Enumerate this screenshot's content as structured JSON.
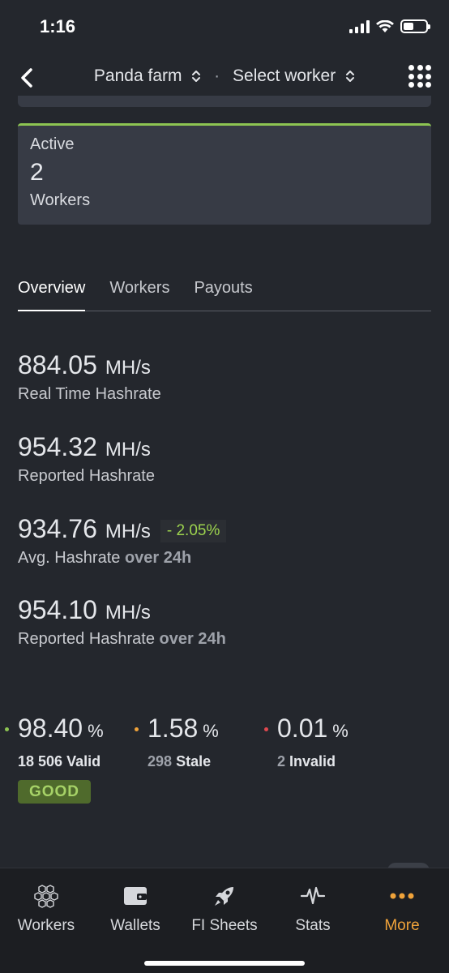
{
  "status_bar": {
    "time": "1:16"
  },
  "nav": {
    "farm": "Panda farm",
    "separator": "·",
    "worker": "Select worker"
  },
  "active_card": {
    "label": "Active",
    "value": "2",
    "sub": "Workers"
  },
  "tabs": [
    {
      "label": "Overview",
      "active": true
    },
    {
      "label": "Workers",
      "active": false
    },
    {
      "label": "Payouts",
      "active": false
    }
  ],
  "stats": {
    "real_time": {
      "value": "884.05",
      "unit": "MH/s",
      "label": "Real Time Hashrate"
    },
    "reported": {
      "value": "954.32",
      "unit": "MH/s",
      "label": "Reported Hashrate"
    },
    "average": {
      "value": "934.76",
      "unit": "MH/s",
      "delta": "- 2.05%",
      "label": "Avg. Hashrate",
      "period": "over 24h"
    },
    "reported_24h": {
      "value": "954.10",
      "unit": "MH/s",
      "label": "Reported Hashrate",
      "period": "over 24h"
    }
  },
  "shares": {
    "valid": {
      "pct": "98.40",
      "unit": "%",
      "count": "18 506",
      "label": "Valid",
      "color": "#8dc452"
    },
    "stale": {
      "pct": "1.58",
      "unit": "%",
      "count": "298",
      "label": "Stale",
      "color": "#f0a33a"
    },
    "invalid": {
      "pct": "0.01",
      "unit": "%",
      "count": "2",
      "label": "Invalid",
      "color": "#e0484f"
    },
    "badge": "GOOD"
  },
  "tabbar": [
    {
      "label": "Workers",
      "icon": "hexagons-icon"
    },
    {
      "label": "Wallets",
      "icon": "wallet-icon"
    },
    {
      "label": "FI Sheets",
      "icon": "rocket-icon"
    },
    {
      "label": "Stats",
      "icon": "pulse-icon"
    },
    {
      "label": "More",
      "icon": "more-dots-icon",
      "active": true
    }
  ],
  "colors": {
    "background": "#24272d",
    "card": "#373b45",
    "accent_green": "#8dc452",
    "accent_orange": "#f0a33a"
  }
}
